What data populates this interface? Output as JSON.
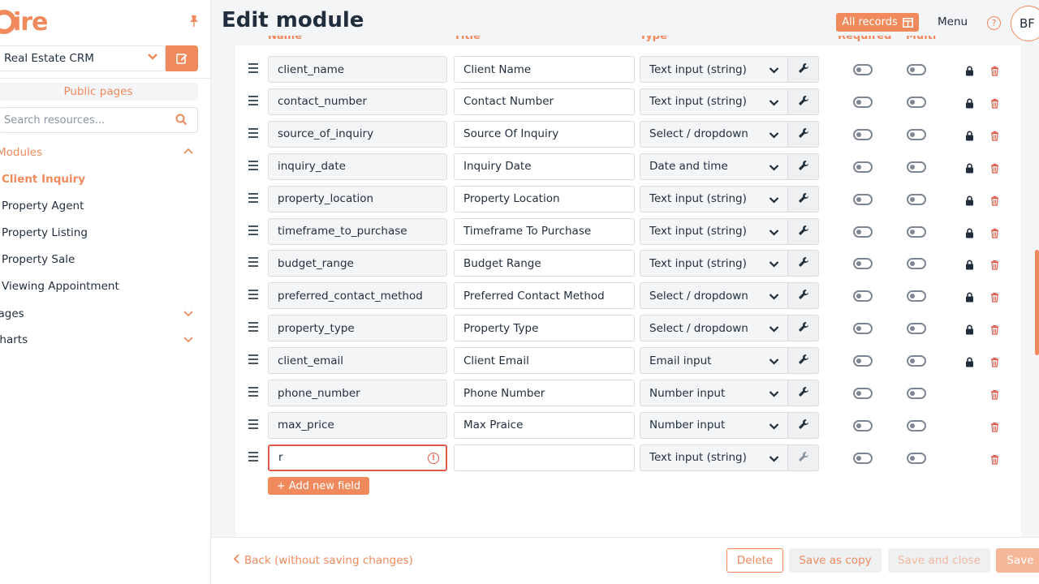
{
  "colors": {
    "accent": "#f08a5d",
    "text": "#1f2d3d",
    "error": "#e05a4a"
  },
  "sidebar": {
    "logo_text": "aire",
    "app_select_value": "Real Estate CRM",
    "public_pages_label": "Public pages",
    "search_placeholder": "Search resources...",
    "sections": {
      "modules": "Modules",
      "pages": "Pages",
      "charts": "Charts"
    },
    "modules": [
      {
        "label": "Client Inquiry",
        "active": true
      },
      {
        "label": "Property Agent",
        "active": false
      },
      {
        "label": "Property Listing",
        "active": false
      },
      {
        "label": "Property Sale",
        "active": false
      },
      {
        "label": "Viewing Appointment",
        "active": false
      }
    ]
  },
  "header": {
    "title": "Edit module",
    "all_records_label": "All records",
    "menu_label": "Menu",
    "help_icon": "?",
    "avatar_initials": "BF"
  },
  "columns": {
    "name": "Name",
    "title": "Title",
    "type": "Type",
    "required": "Required",
    "multi": "Multi"
  },
  "fields": [
    {
      "name": "client_name",
      "title": "Client Name",
      "type": "Text input (string)",
      "locked": true,
      "error": false
    },
    {
      "name": "contact_number",
      "title": "Contact Number",
      "type": "Text input (string)",
      "locked": true,
      "error": false
    },
    {
      "name": "source_of_inquiry",
      "title": "Source Of Inquiry",
      "type": "Select / dropdown",
      "locked": true,
      "error": false
    },
    {
      "name": "inquiry_date",
      "title": "Inquiry Date",
      "type": "Date and time",
      "locked": true,
      "error": false
    },
    {
      "name": "property_location",
      "title": "Property Location",
      "type": "Text input (string)",
      "locked": true,
      "error": false
    },
    {
      "name": "timeframe_to_purchase",
      "title": "Timeframe To Purchase",
      "type": "Text input (string)",
      "locked": true,
      "error": false
    },
    {
      "name": "budget_range",
      "title": "Budget Range",
      "type": "Text input (string)",
      "locked": true,
      "error": false
    },
    {
      "name": "preferred_contact_method",
      "title": "Preferred Contact Method",
      "type": "Select / dropdown",
      "locked": true,
      "error": false
    },
    {
      "name": "property_type",
      "title": "Property Type",
      "type": "Select / dropdown",
      "locked": true,
      "error": false
    },
    {
      "name": "client_email",
      "title": "Client Email",
      "type": "Email input",
      "locked": true,
      "error": false
    },
    {
      "name": "phone_number",
      "title": "Phone Number",
      "type": "Number input",
      "locked": false,
      "error": false
    },
    {
      "name": "max_price",
      "title": "Max Praice",
      "type": "Number input",
      "locked": false,
      "error": false
    },
    {
      "name": "r",
      "title": "",
      "type": "Text input (string)",
      "locked": false,
      "error": true
    }
  ],
  "add_field_label": "+ Add new field",
  "footer": {
    "back_label": "Back (without saving changes)",
    "delete_label": "Delete",
    "save_copy_label": "Save as copy",
    "save_close_label": "Save and close",
    "save_label": "Save"
  }
}
